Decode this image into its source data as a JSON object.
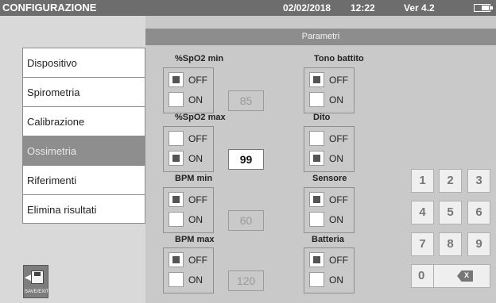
{
  "topbar": {
    "title": "CONFIGURAZIONE",
    "date": "02/02/2018",
    "time": "12:22",
    "version": "Ver 4.2"
  },
  "menu": {
    "items": [
      {
        "label": "Dispositivo",
        "active": false
      },
      {
        "label": "Spirometria",
        "active": false
      },
      {
        "label": "Calibrazione",
        "active": false
      },
      {
        "label": "Ossimetria",
        "active": true
      },
      {
        "label": "Riferimenti",
        "active": false
      },
      {
        "label": "Elimina risultati",
        "active": false
      }
    ]
  },
  "save_exit_label": "SAVE/EXIT",
  "params_header": "Parametri",
  "options": {
    "off": "OFF",
    "on": "ON"
  },
  "groups": {
    "spo2_min": {
      "label": "%SpO2 min",
      "selected": "OFF",
      "value": "85"
    },
    "spo2_max": {
      "label": "%SpO2 max",
      "selected": "ON",
      "value": "99"
    },
    "bpm_min": {
      "label": "BPM min",
      "selected": "OFF",
      "value": "60"
    },
    "bpm_max": {
      "label": "BPM max",
      "selected": "OFF",
      "value": "120"
    },
    "tono": {
      "label": "Tono battito",
      "selected": "OFF"
    },
    "dito": {
      "label": "Dito",
      "selected": "ON"
    },
    "sensore": {
      "label": "Sensore",
      "selected": "OFF"
    },
    "batteria": {
      "label": "Batteria",
      "selected": "OFF"
    }
  },
  "keypad": {
    "keys": [
      "1",
      "2",
      "3",
      "4",
      "5",
      "6",
      "7",
      "8",
      "9",
      "0"
    ],
    "backspace_label": "X"
  },
  "icons": {
    "battery": "battery-icon",
    "save_exit": "save-exit-icon",
    "backspace": "backspace-icon"
  },
  "colors": {
    "topbar": "#6d6d6d",
    "active_menu": "#8e8e8e",
    "header": "#8d8d8d",
    "background": "#c9c9c9"
  }
}
